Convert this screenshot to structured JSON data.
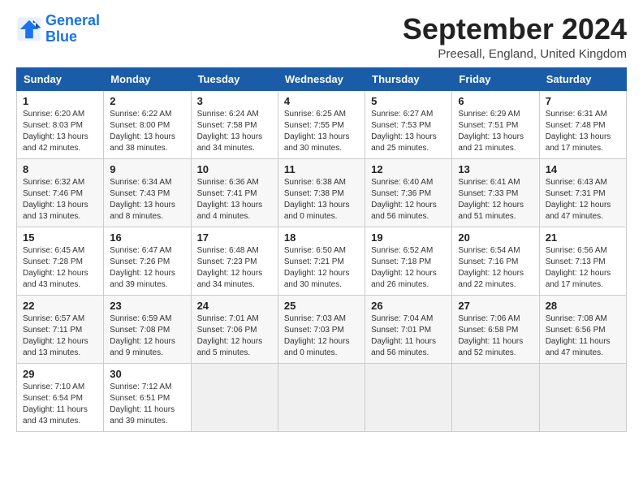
{
  "logo": {
    "line1": "General",
    "line2": "Blue"
  },
  "title": "September 2024",
  "location": "Preesall, England, United Kingdom",
  "headers": [
    "Sunday",
    "Monday",
    "Tuesday",
    "Wednesday",
    "Thursday",
    "Friday",
    "Saturday"
  ],
  "weeks": [
    [
      {
        "day": "1",
        "sunrise": "6:20 AM",
        "sunset": "8:03 PM",
        "daylight": "13 hours and 42 minutes."
      },
      {
        "day": "2",
        "sunrise": "6:22 AM",
        "sunset": "8:00 PM",
        "daylight": "13 hours and 38 minutes."
      },
      {
        "day": "3",
        "sunrise": "6:24 AM",
        "sunset": "7:58 PM",
        "daylight": "13 hours and 34 minutes."
      },
      {
        "day": "4",
        "sunrise": "6:25 AM",
        "sunset": "7:55 PM",
        "daylight": "13 hours and 30 minutes."
      },
      {
        "day": "5",
        "sunrise": "6:27 AM",
        "sunset": "7:53 PM",
        "daylight": "13 hours and 25 minutes."
      },
      {
        "day": "6",
        "sunrise": "6:29 AM",
        "sunset": "7:51 PM",
        "daylight": "13 hours and 21 minutes."
      },
      {
        "day": "7",
        "sunrise": "6:31 AM",
        "sunset": "7:48 PM",
        "daylight": "13 hours and 17 minutes."
      }
    ],
    [
      {
        "day": "8",
        "sunrise": "6:32 AM",
        "sunset": "7:46 PM",
        "daylight": "13 hours and 13 minutes."
      },
      {
        "day": "9",
        "sunrise": "6:34 AM",
        "sunset": "7:43 PM",
        "daylight": "13 hours and 8 minutes."
      },
      {
        "day": "10",
        "sunrise": "6:36 AM",
        "sunset": "7:41 PM",
        "daylight": "13 hours and 4 minutes."
      },
      {
        "day": "11",
        "sunrise": "6:38 AM",
        "sunset": "7:38 PM",
        "daylight": "13 hours and 0 minutes."
      },
      {
        "day": "12",
        "sunrise": "6:40 AM",
        "sunset": "7:36 PM",
        "daylight": "12 hours and 56 minutes."
      },
      {
        "day": "13",
        "sunrise": "6:41 AM",
        "sunset": "7:33 PM",
        "daylight": "12 hours and 51 minutes."
      },
      {
        "day": "14",
        "sunrise": "6:43 AM",
        "sunset": "7:31 PM",
        "daylight": "12 hours and 47 minutes."
      }
    ],
    [
      {
        "day": "15",
        "sunrise": "6:45 AM",
        "sunset": "7:28 PM",
        "daylight": "12 hours and 43 minutes."
      },
      {
        "day": "16",
        "sunrise": "6:47 AM",
        "sunset": "7:26 PM",
        "daylight": "12 hours and 39 minutes."
      },
      {
        "day": "17",
        "sunrise": "6:48 AM",
        "sunset": "7:23 PM",
        "daylight": "12 hours and 34 minutes."
      },
      {
        "day": "18",
        "sunrise": "6:50 AM",
        "sunset": "7:21 PM",
        "daylight": "12 hours and 30 minutes."
      },
      {
        "day": "19",
        "sunrise": "6:52 AM",
        "sunset": "7:18 PM",
        "daylight": "12 hours and 26 minutes."
      },
      {
        "day": "20",
        "sunrise": "6:54 AM",
        "sunset": "7:16 PM",
        "daylight": "12 hours and 22 minutes."
      },
      {
        "day": "21",
        "sunrise": "6:56 AM",
        "sunset": "7:13 PM",
        "daylight": "12 hours and 17 minutes."
      }
    ],
    [
      {
        "day": "22",
        "sunrise": "6:57 AM",
        "sunset": "7:11 PM",
        "daylight": "12 hours and 13 minutes."
      },
      {
        "day": "23",
        "sunrise": "6:59 AM",
        "sunset": "7:08 PM",
        "daylight": "12 hours and 9 minutes."
      },
      {
        "day": "24",
        "sunrise": "7:01 AM",
        "sunset": "7:06 PM",
        "daylight": "12 hours and 5 minutes."
      },
      {
        "day": "25",
        "sunrise": "7:03 AM",
        "sunset": "7:03 PM",
        "daylight": "12 hours and 0 minutes."
      },
      {
        "day": "26",
        "sunrise": "7:04 AM",
        "sunset": "7:01 PM",
        "daylight": "11 hours and 56 minutes."
      },
      {
        "day": "27",
        "sunrise": "7:06 AM",
        "sunset": "6:58 PM",
        "daylight": "11 hours and 52 minutes."
      },
      {
        "day": "28",
        "sunrise": "7:08 AM",
        "sunset": "6:56 PM",
        "daylight": "11 hours and 47 minutes."
      }
    ],
    [
      {
        "day": "29",
        "sunrise": "7:10 AM",
        "sunset": "6:54 PM",
        "daylight": "11 hours and 43 minutes."
      },
      {
        "day": "30",
        "sunrise": "7:12 AM",
        "sunset": "6:51 PM",
        "daylight": "11 hours and 39 minutes."
      },
      null,
      null,
      null,
      null,
      null
    ]
  ]
}
